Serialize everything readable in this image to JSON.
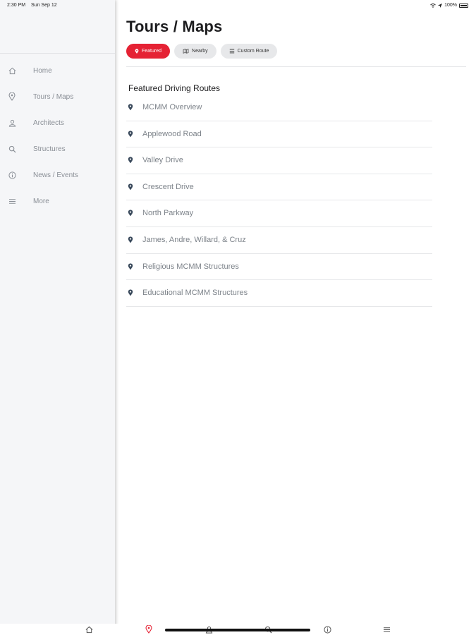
{
  "status_bar": {
    "time": "2:30 PM",
    "date": "Sun Sep 12",
    "battery": "100%"
  },
  "sidebar": {
    "items": [
      {
        "label": "Home",
        "icon": "home-icon"
      },
      {
        "label": "Tours / Maps",
        "icon": "map-pin-icon"
      },
      {
        "label": "Architects",
        "icon": "person-icon"
      },
      {
        "label": "Structures",
        "icon": "search-icon"
      },
      {
        "label": "News / Events",
        "icon": "info-icon"
      },
      {
        "label": "More",
        "icon": "menu-icon"
      }
    ]
  },
  "main": {
    "title": "Tours / Maps",
    "segments": [
      {
        "label": "Featured",
        "icon": "map-pin-icon",
        "active": true
      },
      {
        "label": "Nearby",
        "icon": "map-icon",
        "active": false
      },
      {
        "label": "Custom Route",
        "icon": "list-icon",
        "active": false
      }
    ],
    "section_title": "Featured Driving Routes",
    "routes": [
      "MCMM Overview",
      "Applewood Road",
      "Valley Drive",
      "Crescent Drive",
      "North Parkway",
      "James, Andre, Willard, & Cruz",
      "Religious MCMM Structures",
      "Educational MCMM Structures"
    ]
  },
  "tab_bar": {
    "tabs": [
      "home-icon",
      "map-pin-icon",
      "person-icon",
      "search-icon",
      "info-icon",
      "menu-icon"
    ],
    "active_tab": "map-pin-icon"
  },
  "colors": {
    "accent": "#e52234",
    "pin": "#3a4a5c",
    "sidebar_bg": "#f5f6f8",
    "muted_text": "#8a8f96"
  }
}
